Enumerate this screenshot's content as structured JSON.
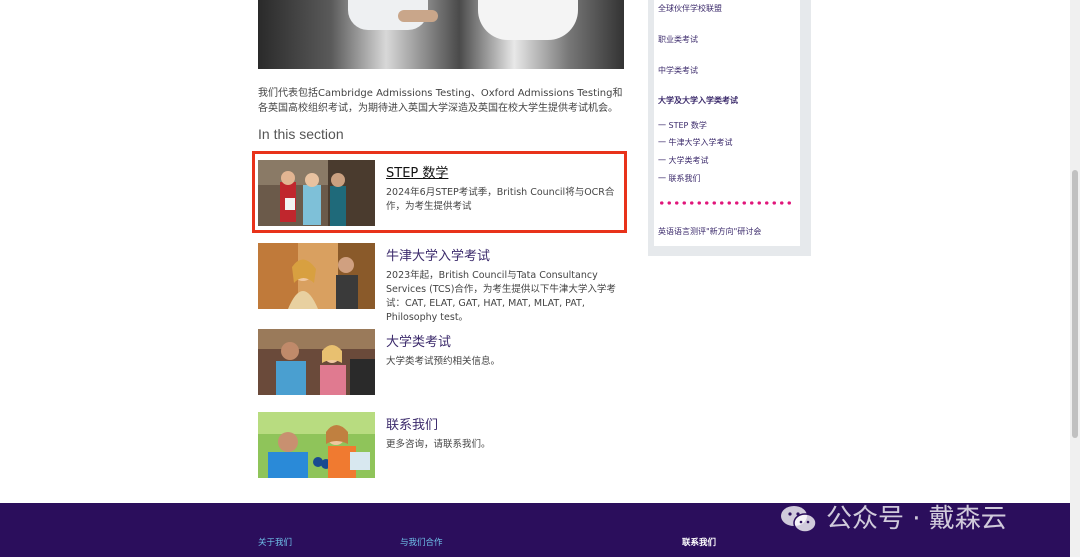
{
  "intro": "我们代表包括Cambridge Admissions Testing、Oxford Admissions Testing和各英国高校组织考试，为期待进入英国大学深造及英国在校大学生提供考试机会。",
  "section_title": "In this section",
  "items": [
    {
      "title": "STEP 数学",
      "desc": "2024年6月STEP考试季，British Council将与OCR合作，为考生提供考试"
    },
    {
      "title": "牛津大学入学考试",
      "desc": "2023年起，British Council与Tata Consultancy Services (TCS)合作，为考生提供以下牛津大学入学考试：CAT, ELAT, GAT, HAT, MAT, MLAT, PAT, Philosophy test。"
    },
    {
      "title": "大学类考试",
      "desc": "大学类考试预约相关信息。"
    },
    {
      "title": "联系我们",
      "desc": "更多咨询，请联系我们。"
    }
  ],
  "sidebar": {
    "links": [
      "全球伙伴学校联盟",
      "职业类考试",
      "中学类考试",
      "大学及大学入学类考试"
    ],
    "sub": [
      "一 STEP 数学",
      "一 牛津大学入学考试",
      "一 大学类考试",
      "一 联系我们"
    ],
    "bottom_link": "英语语言测评\"新方向\"研讨会"
  },
  "footer": {
    "links": [
      "关于我们",
      "与我们合作",
      "联系我们"
    ]
  },
  "watermark": "公众号 · 戴森云",
  "colors": {
    "footer": "#2b0e5c",
    "highlight": "#e8321a",
    "dots": "#e0157a"
  }
}
